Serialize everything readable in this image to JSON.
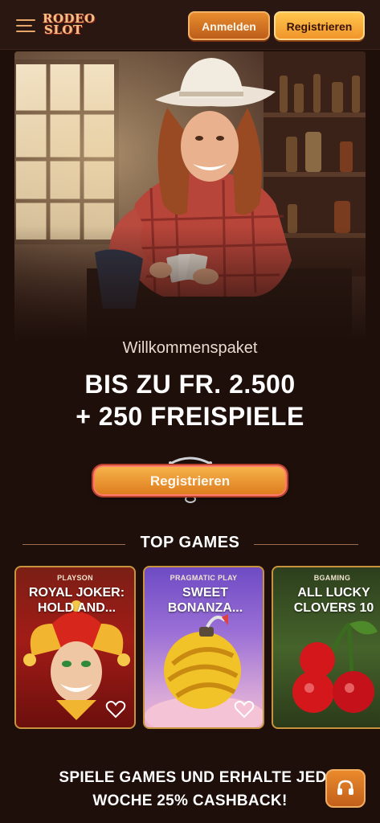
{
  "header": {
    "logo_line1": "RODEO",
    "logo_line2": "SLOT",
    "login_label": "Anmelden",
    "register_label": "Registrieren",
    "menu_icon": "hamburger-menu-icon"
  },
  "hero": {
    "welcome": "Willkommenspaket",
    "bonus_line1": "BIS ZU FR. 2.500",
    "bonus_line2": "+ 250 FREISPIELE",
    "cta_label": "Registrieren"
  },
  "top_games": {
    "title": "TOP GAMES",
    "items": [
      {
        "provider": "PLAYSON",
        "title": "ROYAL JOKER: HOLD AND..."
      },
      {
        "provider": "PRAGMATIC PLAY",
        "title": "SWEET BONANZA..."
      },
      {
        "provider": "BGAMING",
        "title": "ALL LUCKY CLOVERS 10"
      }
    ]
  },
  "cashback": {
    "line1": "SPIELE GAMES UND ERHALTE JEDE",
    "line2": "WOCHE 25% CASHBACK!"
  },
  "colors": {
    "background": "#1e0f0b",
    "header": "#2a1712",
    "accent_orange": "#e98d2e",
    "accent_yellow": "#ffc64d",
    "card_border": "#c7943d"
  }
}
